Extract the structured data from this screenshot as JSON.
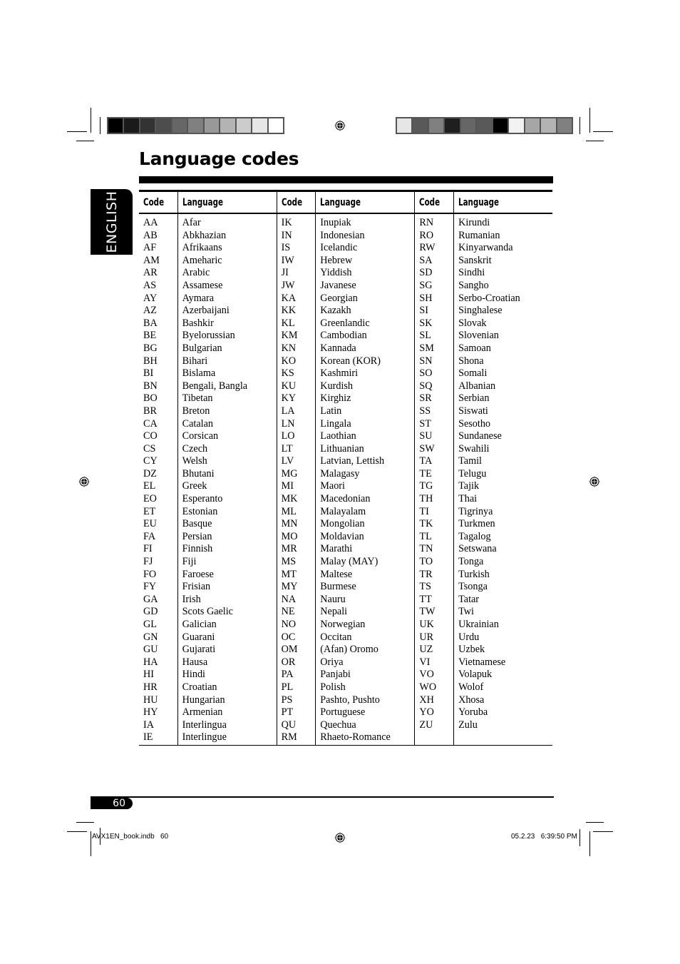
{
  "page": {
    "title": "Language codes",
    "side_tab": "ENGLISH",
    "page_number": "60",
    "slug_left": "AVX1EN_book.indb   60",
    "slug_right": "05.2.23   6:39:50 PM"
  },
  "color_bars": {
    "left": [
      "#000000",
      "#1a1a1a",
      "#333333",
      "#4d4d4d",
      "#666666",
      "#808080",
      "#999999",
      "#b3b3b3",
      "#cccccc",
      "#e6e6e6",
      "#ffffff"
    ],
    "right": [
      "#e6e6e6",
      "#595959",
      "#808080",
      "#1f1f1f",
      "#666666",
      "#595959",
      "#000000",
      "#f2f2f2",
      "#a6a6a6",
      "#b3b3b3",
      "#808080"
    ]
  },
  "table": {
    "headers": [
      "Code",
      "Language",
      "Code",
      "Language",
      "Code",
      "Language"
    ],
    "columns": [
      [
        [
          "AA",
          "Afar"
        ],
        [
          "AB",
          "Abkhazian"
        ],
        [
          "AF",
          "Afrikaans"
        ],
        [
          "AM",
          "Ameharic"
        ],
        [
          "AR",
          "Arabic"
        ],
        [
          "AS",
          "Assamese"
        ],
        [
          "AY",
          "Aymara"
        ],
        [
          "AZ",
          "Azerbaijani"
        ],
        [
          "BA",
          "Bashkir"
        ],
        [
          "BE",
          "Byelorussian"
        ],
        [
          "BG",
          "Bulgarian"
        ],
        [
          "BH",
          "Bihari"
        ],
        [
          "BI",
          "Bislama"
        ],
        [
          "BN",
          "Bengali, Bangla"
        ],
        [
          "BO",
          "Tibetan"
        ],
        [
          "BR",
          "Breton"
        ],
        [
          "CA",
          "Catalan"
        ],
        [
          "CO",
          "Corsican"
        ],
        [
          "CS",
          "Czech"
        ],
        [
          "CY",
          "Welsh"
        ],
        [
          "DZ",
          "Bhutani"
        ],
        [
          "EL",
          "Greek"
        ],
        [
          "EO",
          "Esperanto"
        ],
        [
          "ET",
          "Estonian"
        ],
        [
          "EU",
          "Basque"
        ],
        [
          "FA",
          "Persian"
        ],
        [
          "FI",
          "Finnish"
        ],
        [
          "FJ",
          "Fiji"
        ],
        [
          "FO",
          "Faroese"
        ],
        [
          "FY",
          "Frisian"
        ],
        [
          "GA",
          "Irish"
        ],
        [
          "GD",
          "Scots Gaelic"
        ],
        [
          "GL",
          "Galician"
        ],
        [
          "GN",
          "Guarani"
        ],
        [
          "GU",
          "Gujarati"
        ],
        [
          "HA",
          "Hausa"
        ],
        [
          "HI",
          "Hindi"
        ],
        [
          "HR",
          "Croatian"
        ],
        [
          "HU",
          "Hungarian"
        ],
        [
          "HY",
          "Armenian"
        ],
        [
          "IA",
          "Interlingua"
        ],
        [
          "IE",
          "Interlingue"
        ]
      ],
      [
        [
          "IK",
          "Inupiak"
        ],
        [
          "IN",
          "Indonesian"
        ],
        [
          "IS",
          "Icelandic"
        ],
        [
          "IW",
          "Hebrew"
        ],
        [
          "JI",
          "Yiddish"
        ],
        [
          "JW",
          "Javanese"
        ],
        [
          "KA",
          "Georgian"
        ],
        [
          "KK",
          "Kazakh"
        ],
        [
          "KL",
          "Greenlandic"
        ],
        [
          "KM",
          "Cambodian"
        ],
        [
          "KN",
          "Kannada"
        ],
        [
          "KO",
          "Korean (KOR)"
        ],
        [
          "KS",
          "Kashmiri"
        ],
        [
          "KU",
          "Kurdish"
        ],
        [
          "KY",
          "Kirghiz"
        ],
        [
          "LA",
          "Latin"
        ],
        [
          "LN",
          "Lingala"
        ],
        [
          "LO",
          "Laothian"
        ],
        [
          "LT",
          "Lithuanian"
        ],
        [
          "LV",
          "Latvian, Lettish"
        ],
        [
          "MG",
          "Malagasy"
        ],
        [
          "MI",
          "Maori"
        ],
        [
          "MK",
          "Macedonian"
        ],
        [
          "ML",
          "Malayalam"
        ],
        [
          "MN",
          "Mongolian"
        ],
        [
          "MO",
          "Moldavian"
        ],
        [
          "MR",
          "Marathi"
        ],
        [
          "MS",
          "Malay (MAY)"
        ],
        [
          "MT",
          "Maltese"
        ],
        [
          "MY",
          "Burmese"
        ],
        [
          "NA",
          "Nauru"
        ],
        [
          "NE",
          "Nepali"
        ],
        [
          "NO",
          "Norwegian"
        ],
        [
          "OC",
          "Occitan"
        ],
        [
          "OM",
          "(Afan) Oromo"
        ],
        [
          "OR",
          "Oriya"
        ],
        [
          "PA",
          "Panjabi"
        ],
        [
          "PL",
          "Polish"
        ],
        [
          "PS",
          "Pashto, Pushto"
        ],
        [
          "PT",
          "Portuguese"
        ],
        [
          "QU",
          "Quechua"
        ],
        [
          "RM",
          "Rhaeto-Romance"
        ]
      ],
      [
        [
          "RN",
          "Kirundi"
        ],
        [
          "RO",
          "Rumanian"
        ],
        [
          "RW",
          "Kinyarwanda"
        ],
        [
          "SA",
          "Sanskrit"
        ],
        [
          "SD",
          "Sindhi"
        ],
        [
          "SG",
          "Sangho"
        ],
        [
          "SH",
          "Serbo-Croatian"
        ],
        [
          "SI",
          "Singhalese"
        ],
        [
          "SK",
          "Slovak"
        ],
        [
          "SL",
          "Slovenian"
        ],
        [
          "SM",
          "Samoan"
        ],
        [
          "SN",
          "Shona"
        ],
        [
          "SO",
          "Somali"
        ],
        [
          "SQ",
          "Albanian"
        ],
        [
          "SR",
          "Serbian"
        ],
        [
          "SS",
          "Siswati"
        ],
        [
          "ST",
          "Sesotho"
        ],
        [
          "SU",
          "Sundanese"
        ],
        [
          "SW",
          "Swahili"
        ],
        [
          "TA",
          "Tamil"
        ],
        [
          "TE",
          "Telugu"
        ],
        [
          "TG",
          "Tajik"
        ],
        [
          "TH",
          "Thai"
        ],
        [
          "TI",
          "Tigrinya"
        ],
        [
          "TK",
          "Turkmen"
        ],
        [
          "TL",
          "Tagalog"
        ],
        [
          "TN",
          "Setswana"
        ],
        [
          "TO",
          "Tonga"
        ],
        [
          "TR",
          "Turkish"
        ],
        [
          "TS",
          "Tsonga"
        ],
        [
          "TT",
          "Tatar"
        ],
        [
          "TW",
          "Twi"
        ],
        [
          "UK",
          "Ukrainian"
        ],
        [
          "UR",
          "Urdu"
        ],
        [
          "UZ",
          "Uzbek"
        ],
        [
          "VI",
          "Vietnamese"
        ],
        [
          "VO",
          "Volapuk"
        ],
        [
          "WO",
          "Wolof"
        ],
        [
          "XH",
          "Xhosa"
        ],
        [
          "YO",
          "Yoruba"
        ],
        [
          "ZU",
          "Zulu"
        ],
        [
          "",
          ""
        ]
      ]
    ]
  }
}
